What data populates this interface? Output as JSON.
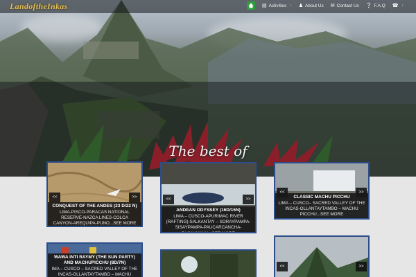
{
  "brand": {
    "logo_text": "LandoftheInkas"
  },
  "nav": {
    "items": [
      {
        "label": "Activities",
        "icon": "document-icon",
        "has_caret": true
      },
      {
        "label": "About Us",
        "icon": "users-icon",
        "has_caret": false
      },
      {
        "label": "Contact Us",
        "icon": "envelope-icon",
        "has_caret": false
      },
      {
        "label": "F.A.Q",
        "icon": "question-icon",
        "has_caret": false
      }
    ],
    "phone_caret": "↓"
  },
  "hero": {
    "heading": "The best of"
  },
  "cards": [
    {
      "title": "CONQUEST OF THE ANDES (23 D/22 N)",
      "description": "LIMA-PISCO-PARACAS NATIONAL RESERVE-NAZCA LINES-COLCA CANYON-AREQUIPA-PUNO...SEE MORE",
      "prev": "<<",
      "next": ">>"
    },
    {
      "title": "ANDEAN ODYSSEY (16D/15N)",
      "description": "LIMA – CUSCO-APURIMAC RIVER (RAFTING)-SALKANTAY – SORAYPAMPA-SISAYPAMPA-PAUCARCANCHA-PACAYMAYU...SEE MORE",
      "prev": "<<",
      "next": ">>"
    },
    {
      "title": "CLASSIC MACHU PICCHU",
      "description": "LIMA – CUSCO– SACRED VALLEY OF THE INCAS-OLLANTAYTAMBO – MACHU PICCHU...SEE MORE",
      "prev": "<<",
      "next": ">>"
    },
    {
      "title": "WAWA INTI RAYMY (THE SUN PARTY) AND MACHUPICCHU (8D/7N)",
      "description": "IMA – CUSCO – SACRED VALLEY OF THE INCAS-OLLANTAYTAMBO – MACHU PICC...",
      "prev": "<<",
      "next": ">>"
    },
    {
      "title": "",
      "description": "",
      "prev": "<<",
      "next": ">>"
    },
    {
      "title": "",
      "description": "",
      "prev": "<<",
      "next": ">>"
    }
  ],
  "colors": {
    "card_border": "#2d4d8a",
    "home_active": "#2e9e3e",
    "logo": "#e2c05a"
  }
}
